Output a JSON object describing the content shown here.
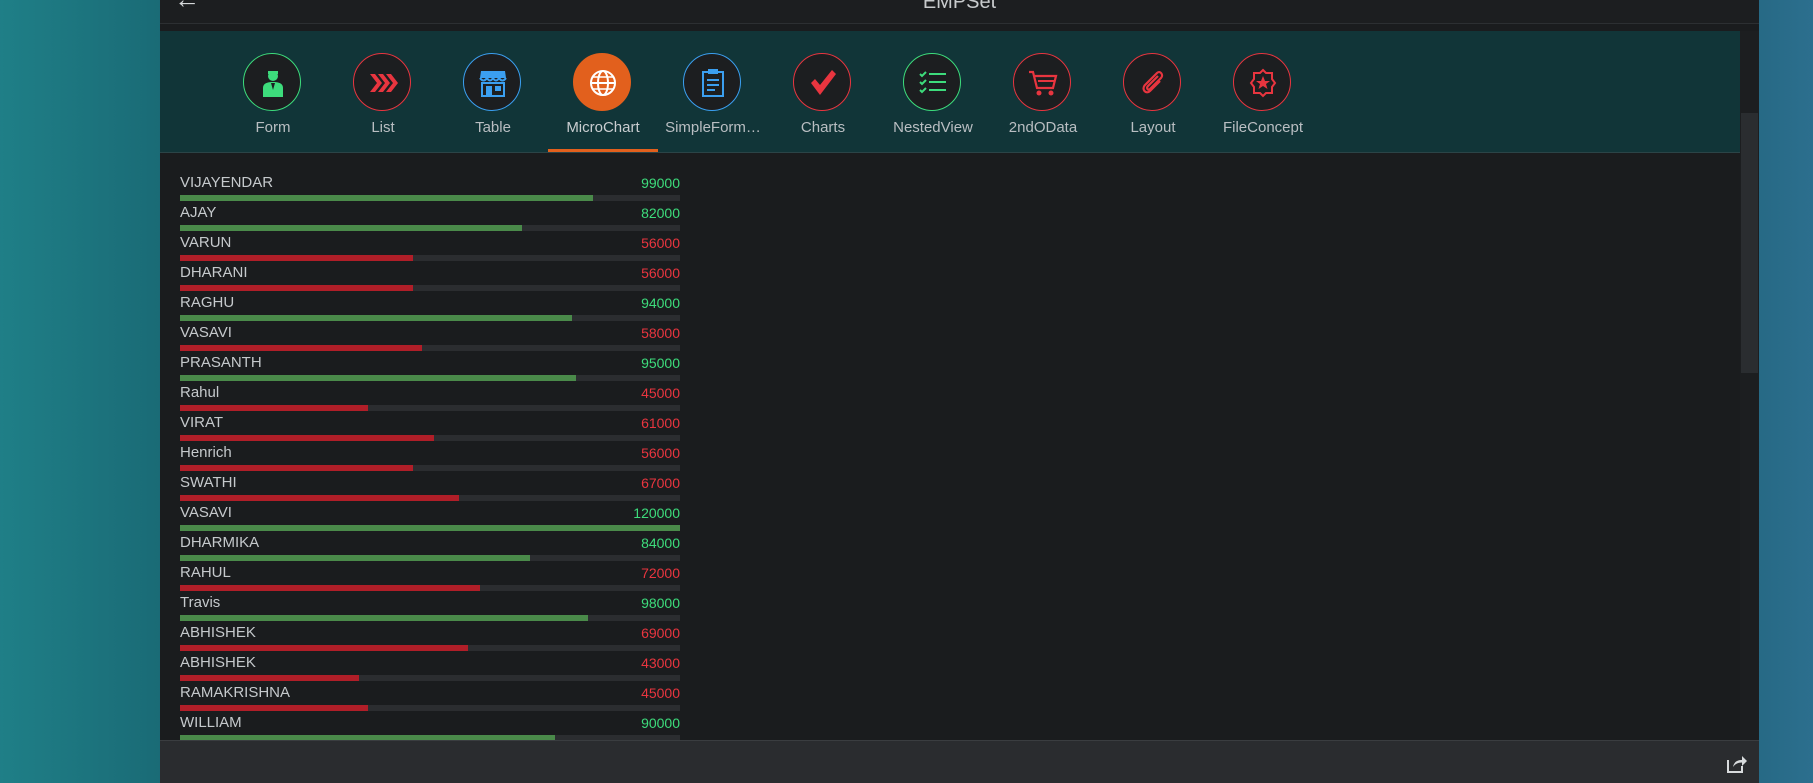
{
  "header": {
    "title": "EMPSet"
  },
  "tabs": [
    {
      "label": "Form",
      "icon": "employee-icon",
      "color": "#3ddc7c",
      "active": false
    },
    {
      "label": "List",
      "icon": "chevrons-right-icon",
      "color": "#e8353f",
      "active": false
    },
    {
      "label": "Table",
      "icon": "store-icon",
      "color": "#3b9ff0",
      "active": false
    },
    {
      "label": "MicroChart",
      "icon": "globe-icon",
      "color": "#e2601d",
      "active": true
    },
    {
      "label": "SimpleForm…",
      "icon": "clipboard-icon",
      "color": "#3b9ff0",
      "active": false
    },
    {
      "label": "Charts",
      "icon": "checkmark-icon",
      "color": "#e8353f",
      "active": false
    },
    {
      "label": "NestedView",
      "icon": "task-list-icon",
      "color": "#3ddc7c",
      "active": false
    },
    {
      "label": "2ndOData",
      "icon": "cart-icon",
      "color": "#e8353f",
      "active": false
    },
    {
      "label": "Layout",
      "icon": "paperclip-icon",
      "color": "#e8353f",
      "active": false
    },
    {
      "label": "FileConcept",
      "icon": "badge-icon",
      "color": "#e8353f",
      "active": false
    }
  ],
  "colors": {
    "good": "#3ddc7c",
    "bad": "#e8353f",
    "good_bar": "#4a8a4a",
    "bad_bar": "#b01e28",
    "accent": "#e2601d"
  },
  "chart_data": {
    "type": "bar",
    "max_value": 120000,
    "threshold": 80000,
    "categories": [
      "VIJAYENDAR",
      "AJAY",
      "VARUN",
      "DHARANI",
      "RAGHU",
      "VASAVI",
      "PRASANTH",
      "Rahul",
      "VIRAT",
      "Henrich",
      "SWATHI",
      "VASAVI",
      "DHARMIKA",
      "RAHUL",
      "Travis",
      "ABHISHEK",
      "ABHISHEK",
      "RAMAKRISHNA",
      "WILLIAM"
    ],
    "values": [
      99000,
      82000,
      56000,
      56000,
      94000,
      58000,
      95000,
      45000,
      61000,
      56000,
      67000,
      120000,
      84000,
      72000,
      98000,
      69000,
      43000,
      45000,
      90000
    ],
    "value_labels": [
      "99000",
      "82000",
      "56000",
      "56000",
      "94000",
      "58000",
      "95000",
      "45000",
      "61000",
      "56000",
      "67000",
      "120000",
      "84000",
      "72000",
      "98000",
      "69000",
      "43000",
      "45000",
      "90000"
    ]
  }
}
